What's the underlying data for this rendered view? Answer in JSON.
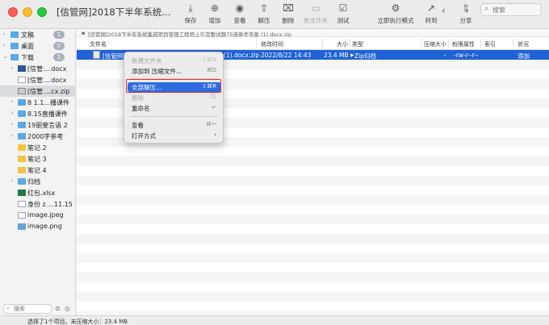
{
  "window": {
    "title": "[信管网]2018下半年系统集成项目管..."
  },
  "toolbar": {
    "buttons": [
      {
        "label": "保存",
        "icon": "save-icon"
      },
      {
        "label": "增加",
        "icon": "add-icon"
      },
      {
        "label": "查看",
        "icon": "eye-icon"
      },
      {
        "label": "解压",
        "icon": "extract-icon"
      },
      {
        "label": "删除",
        "icon": "trash-icon"
      },
      {
        "label": "新文件夹",
        "icon": "new-folder-icon"
      },
      {
        "label": "测试",
        "icon": "test-icon"
      },
      {
        "label": "立即执行模式",
        "icon": "run-mode-icon"
      },
      {
        "label": "转到",
        "icon": "goto-icon"
      },
      {
        "label": "分享",
        "icon": "share-icon"
      }
    ],
    "search_placeholder": "搜索"
  },
  "sidebar": {
    "items": [
      {
        "label": "文稿",
        "badge": "1"
      },
      {
        "label": "桌面",
        "badge": "0"
      },
      {
        "label": "下载",
        "badge": "1"
      },
      {
        "label": "[信管....docx"
      },
      {
        "label": "[信管....docx"
      },
      {
        "label": "[信管....cx.zip"
      },
      {
        "label": "8 1.1...播课件"
      },
      {
        "label": "8.15直播课件"
      },
      {
        "label": "19丽斐言语 2"
      },
      {
        "label": "2000字参考"
      },
      {
        "label": "笔记 2"
      },
      {
        "label": "笔记 3"
      },
      {
        "label": "笔记 4"
      },
      {
        "label": "归档"
      },
      {
        "label": "红包.xlsx"
      },
      {
        "label": "身份 z....11.15"
      },
      {
        "label": "image.jpeg"
      },
      {
        "label": "image.png"
      }
    ],
    "search_placeholder": "搜索"
  },
  "pathbar": {
    "text": "[信管网]2018下半年系统集成项目管理工程师上午完整试题75道参考答案 (1).docx.zip"
  },
  "columns": {
    "name": "文件名",
    "modified": "修改时间",
    "size": "大小",
    "type": "类型",
    "compressed": "压缩大小",
    "permissions": "权限属性",
    "index": "索引",
    "state": "状况"
  },
  "file_row": {
    "name_visible": "[信管网]2",
    "name_tail": "(1).docx.zip",
    "modified": "2022/8/22 14:43",
    "size": "23.4 MB",
    "size_arrow": "▶",
    "type": "Zip归档",
    "compressed": "–",
    "permissions": "-rw-r--r--",
    "index": "",
    "state": "添加"
  },
  "context_menu": {
    "items": [
      {
        "label": "新建文件夹",
        "shortcut": "⇧⌘N",
        "disabled": true
      },
      {
        "label": "添加到 压缩文件...",
        "shortcut": "⌘D",
        "disabled": false
      },
      {
        "label": "全部解压...",
        "shortcut": "⇧⌘R",
        "highlighted": true
      },
      {
        "label": "删除",
        "shortcut": "⌫",
        "disabled": true
      },
      {
        "label": "重命名",
        "shortcut": "↩",
        "disabled": true
      },
      {
        "label": "查看",
        "shortcut": "⌘↩",
        "disabled": false
      },
      {
        "label": "打开方式",
        "shortcut": "›",
        "disabled": false
      }
    ]
  },
  "status": {
    "text": "选择了1个项目。未压缩大小：23.4 MB"
  },
  "colors": {
    "selection": "#1f62d7",
    "highlight": "#2f6be0",
    "annotation": "#e02b2b"
  }
}
